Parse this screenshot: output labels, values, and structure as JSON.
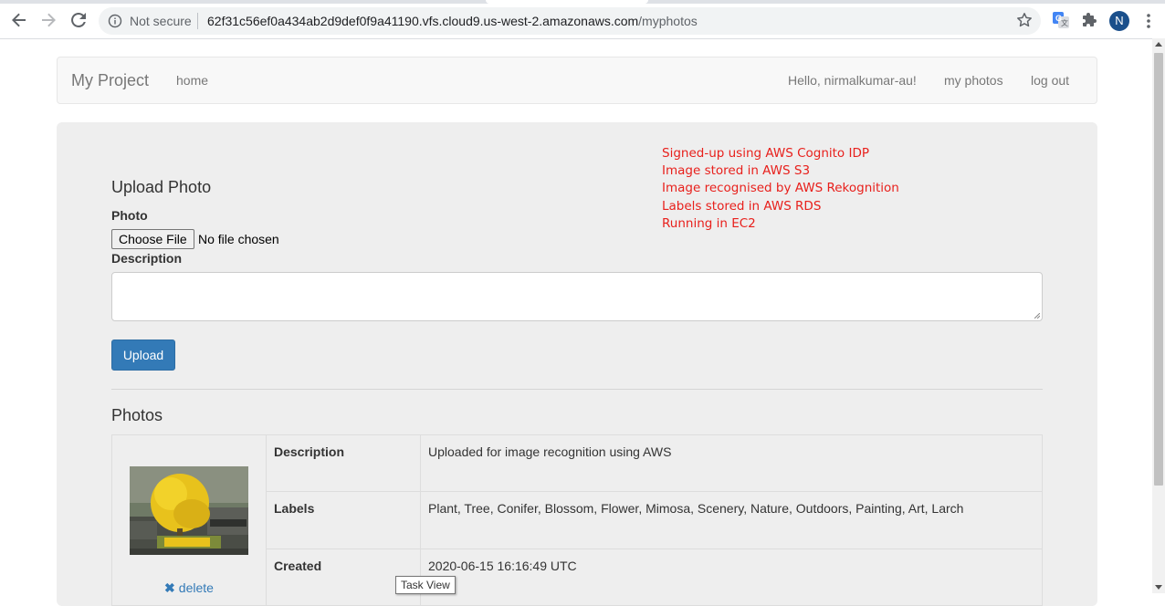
{
  "browser": {
    "security_label": "Not secure",
    "url_host": "62f31c56ef0a434ab2d9def0f9a41190.vfs.cloud9.us-west-2.amazonaws.com",
    "url_path": "/myphotos",
    "profile_initial": "N"
  },
  "navbar": {
    "brand": "My Project",
    "home": "home",
    "greeting": "Hello, nirmalkumar-au!",
    "my_photos": "my photos",
    "logout": "log out"
  },
  "notes": [
    "Signed-up using AWS Cognito IDP",
    "Image stored in AWS S3",
    "Image recognised by AWS Rekognition",
    "Labels stored in AWS RDS",
    "Running in EC2"
  ],
  "upload": {
    "title": "Upload Photo",
    "photo_label": "Photo",
    "choose_file": "Choose File",
    "file_status": "No file chosen",
    "description_label": "Description",
    "description_value": "",
    "upload_button": "Upload"
  },
  "photos": {
    "title": "Photos",
    "rows": [
      {
        "key": "Description",
        "value": "Uploaded for image recognition using AWS"
      },
      {
        "key": "Labels",
        "value": "Plant, Tree, Conifer, Blossom, Flower, Mimosa, Scenery, Nature, Outdoors, Painting, Art, Larch"
      },
      {
        "key": "Created",
        "value": "2020-06-15 16:16:49 UTC"
      }
    ],
    "delete_label": "delete"
  },
  "tooltip": "Task View",
  "colors": {
    "accent": "#337ab7",
    "notes": "#e8201c",
    "jumbotron": "#eeeeee"
  }
}
